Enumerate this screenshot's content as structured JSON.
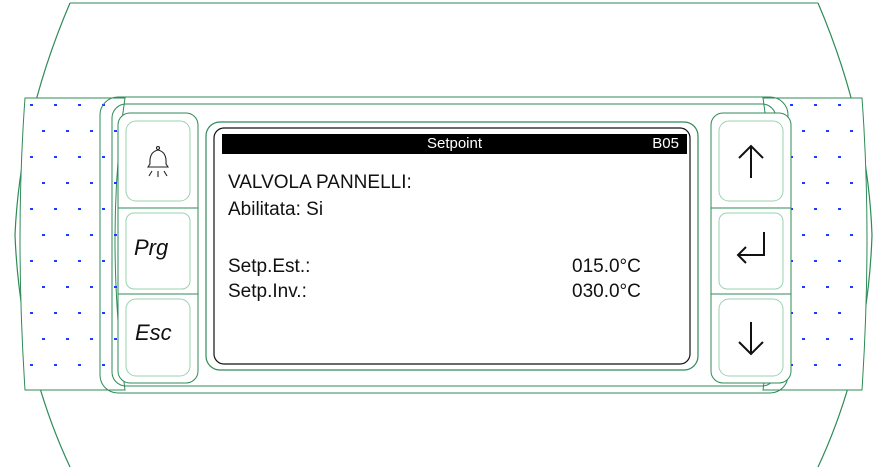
{
  "screen": {
    "header": {
      "title": "Setpoint",
      "code": "B05"
    },
    "lines": [
      "VALVOLA PANNELLI:",
      "Abilitata: Si",
      "",
      "Setp.Est.:",
      "Setp.Inv.:"
    ],
    "values": {
      "setp_est": "015.0°C",
      "setp_inv": "030.0°C"
    }
  },
  "keys": {
    "alarm_icon": "bell-icon",
    "prg_label": "Prg",
    "esc_label": "Esc",
    "up_icon": "arrow-up-icon",
    "enter_icon": "enter-icon",
    "down_icon": "arrow-down-icon"
  },
  "colors": {
    "bezel_line": "#2e8b57",
    "dots": "#1a3cff",
    "lcd_header": "#000000"
  }
}
